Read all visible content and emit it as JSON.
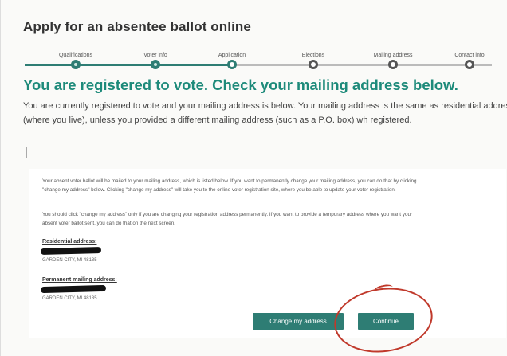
{
  "page": {
    "title": "Apply for an absentee ballot online",
    "heading": "You are registered to vote. Check your mailing address below.",
    "intro": "You are currently registered to vote and your mailing address is below. Your mailing address is the same as residential address (where you live), unless you provided a different mailing address (such as a P.O. box) wh registered."
  },
  "stepper": {
    "steps": [
      {
        "label": "Qualifications",
        "state": "done"
      },
      {
        "label": "Voter info",
        "state": "done"
      },
      {
        "label": "Application",
        "state": "current"
      },
      {
        "label": "Elections",
        "state": "todo"
      },
      {
        "label": "Mailing address",
        "state": "todo"
      },
      {
        "label": "Contact info",
        "state": "todo"
      }
    ]
  },
  "panel": {
    "paragraph1": "Your absent voter ballot will be mailed to your mailing address, which is listed below. If you want to permanently change your mailing address, you can do that by clicking \"change my address\" below. Clicking \"change my address\" will take you to the online voter registration site, where you be able to update your voter registration.",
    "paragraph2": "You should click \"change my address\" only if you are changing your registration address permanently. If you want to provide a temporary address where you want your absent voter ballot sent, you can do that on the next screen.",
    "residential_label": "Residential address:",
    "residential_city": "GARDEN CITY, MI 48135",
    "mailing_label": "Permanent mailing address:",
    "mailing_city": "GARDEN CITY, MI 48135"
  },
  "buttons": {
    "change_address": "Change my address",
    "continue": "Continue"
  },
  "colors": {
    "accent": "#2e7d74",
    "heading": "#1d8a7a",
    "annotation": "#c0392b"
  }
}
